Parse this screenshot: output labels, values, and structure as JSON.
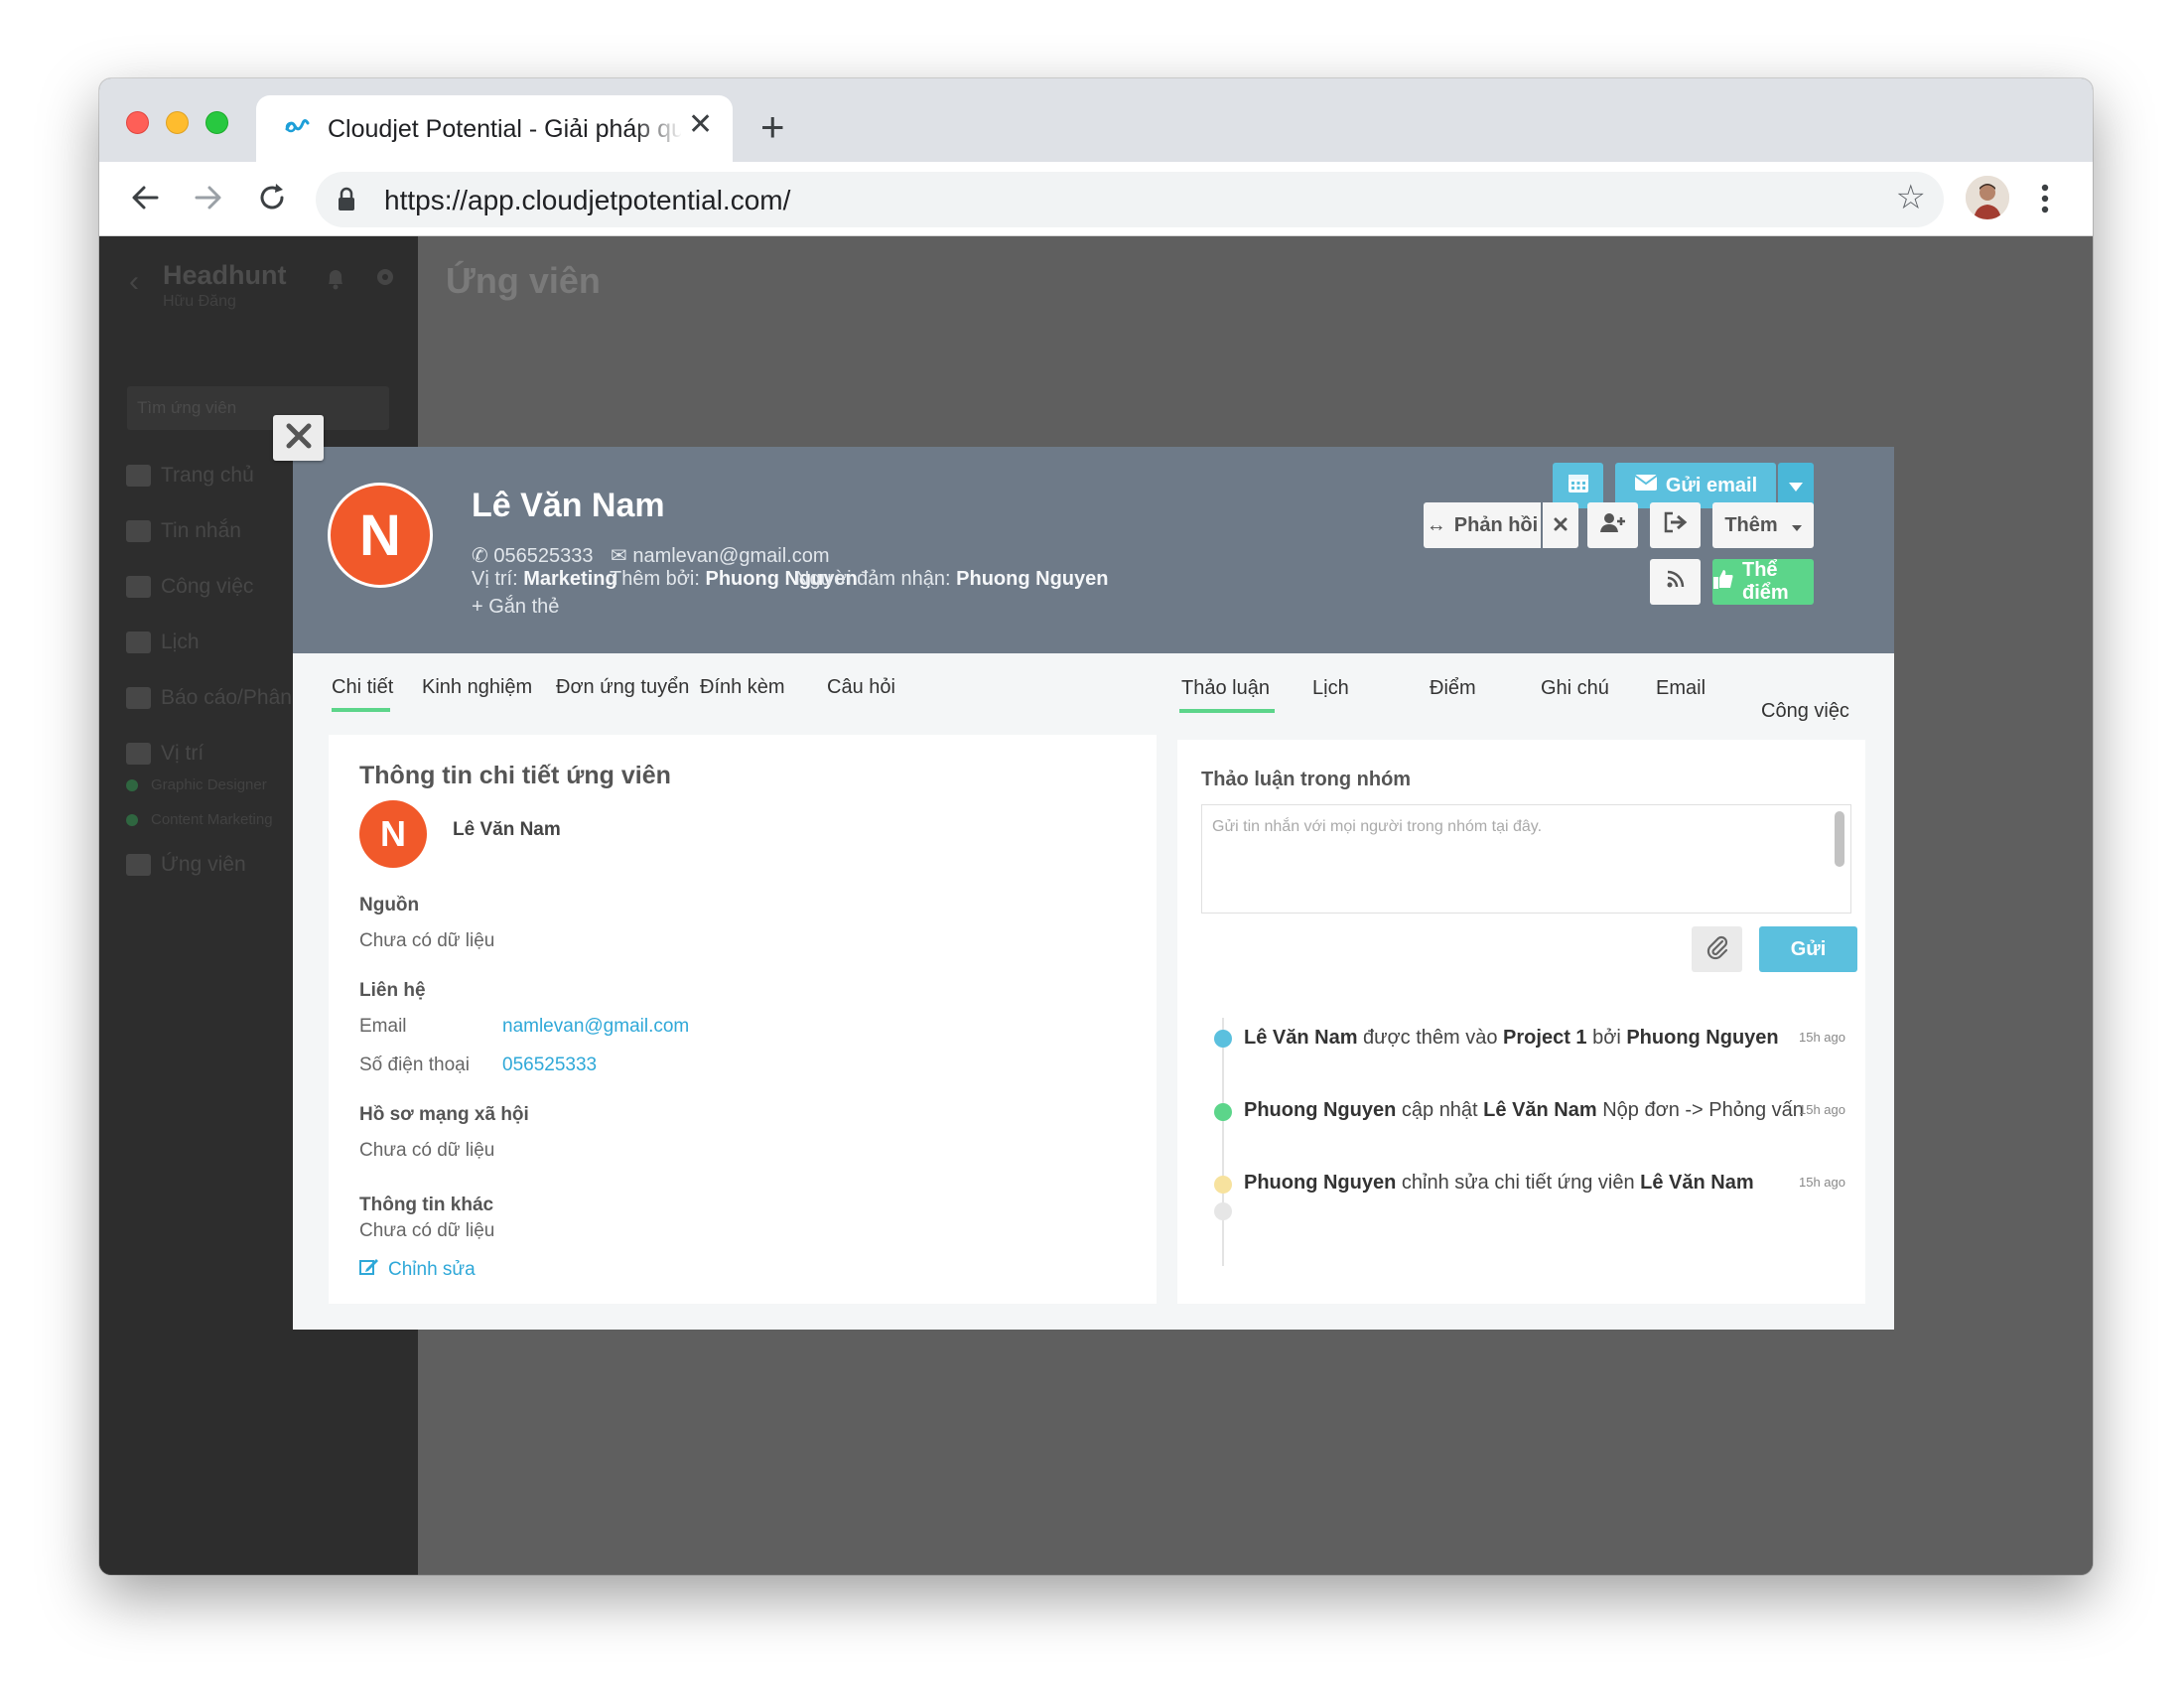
{
  "browser": {
    "tab_title": "Cloudjet Potential - Giải pháp quản",
    "url": "https://app.cloudjetpotential.com/"
  },
  "sidebar": {
    "app_name": "Headhunt",
    "user_name": "Hữu Đăng",
    "search_placeholder": "Tìm ứng viên",
    "items": [
      {
        "label": "Trang chủ",
        "icon": "home-icon"
      },
      {
        "label": "Tin nhắn",
        "icon": "mail-icon"
      },
      {
        "label": "Công việc",
        "icon": "check-icon"
      },
      {
        "label": "Lịch",
        "icon": "calendar-icon"
      },
      {
        "label": "Báo cáo/Phân tích",
        "icon": "chart-icon"
      },
      {
        "label": "Vị trí",
        "icon": "briefcase-icon"
      }
    ],
    "positions": [
      "Graphic Designer",
      "Content Marketing"
    ],
    "candidates_label": "Ứng viên"
  },
  "page": {
    "title": "Ứng viên"
  },
  "candidate": {
    "initial": "N",
    "name": "Lê Văn Nam",
    "phone": "056525333",
    "email": "namlevan@gmail.com",
    "position_label": "Vị trí:",
    "position": "Marketing",
    "added_by_label": "Thêm bởi:",
    "added_by": "Phuong Nguyen",
    "owner_label": "Người đảm nhận:",
    "owner": "Phuong Nguyen",
    "tag_label": "Gắn thẻ"
  },
  "actions": {
    "send_email": "Gửi email",
    "reply": "Phản hồi",
    "more": "Thêm",
    "rate": "Thể điểm"
  },
  "tabs_left": [
    "Chi tiết",
    "Kinh nghiệm",
    "Đơn ứng tuyển",
    "Đính kèm",
    "Câu hỏi"
  ],
  "tabs_right": [
    "Thảo luận",
    "Lịch",
    "Điểm",
    "Ghi chú",
    "Email",
    "Công việc"
  ],
  "details": {
    "title": "Thông tin chi tiết ứng viên",
    "source_label": "Nguồn",
    "no_data": "Chưa có dữ liệu",
    "contact_label": "Liên hệ",
    "email_label": "Email",
    "phone_label": "Số điện thoại",
    "social_label": "Hồ sơ mạng xã hội",
    "other_label": "Thông tin khác",
    "edit_label": "Chỉnh sửa"
  },
  "discussion": {
    "title": "Thảo luận trong nhóm",
    "placeholder": "Gửi tin nhắn với mọi người trong nhóm tại đây.",
    "send": "Gửi",
    "timeline": [
      {
        "color": "#5bc0de",
        "time": "15h ago",
        "parts": [
          [
            "b",
            "Lê Văn Nam"
          ],
          [
            "t",
            " được thêm vào "
          ],
          [
            "b",
            "Project 1"
          ],
          [
            "t",
            " bởi "
          ],
          [
            "b",
            "Phuong Nguyen"
          ]
        ]
      },
      {
        "color": "#5cd58a",
        "time": "15h ago",
        "parts": [
          [
            "b",
            "Phuong Nguyen"
          ],
          [
            "t",
            " cập nhật "
          ],
          [
            "b",
            "Lê Văn Nam"
          ],
          [
            "t",
            " Nộp đơn -> Phỏng vấn"
          ]
        ]
      },
      {
        "color": "#f7e29e",
        "time": "15h ago",
        "parts": [
          [
            "b",
            "Phuong Nguyen"
          ],
          [
            "t",
            " chỉnh sửa chi tiết ứng viên "
          ],
          [
            "b",
            "Lê Văn Nam"
          ]
        ]
      }
    ]
  }
}
